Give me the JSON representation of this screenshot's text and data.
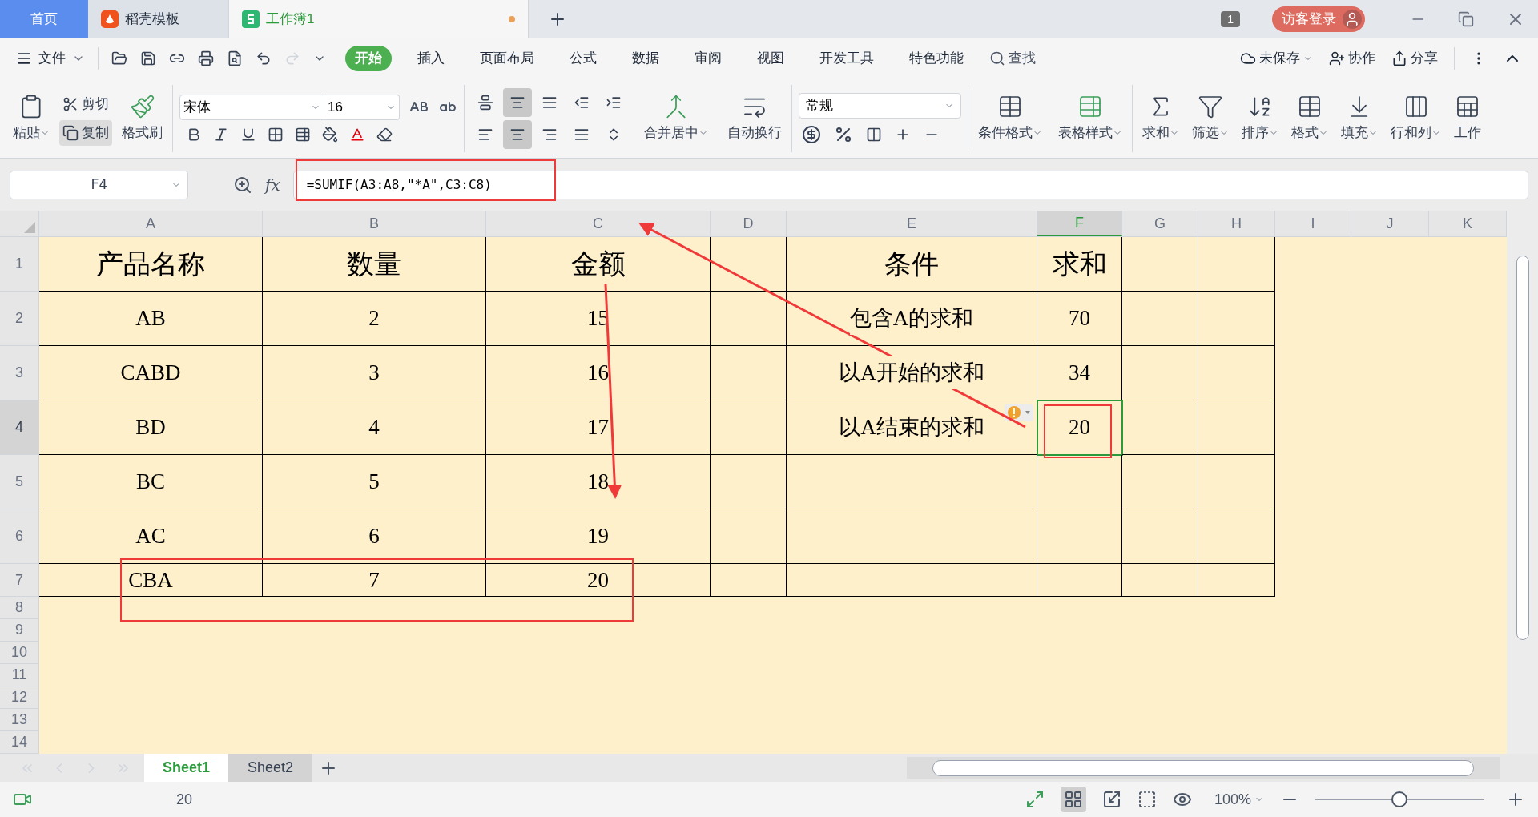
{
  "doc_tabs": [
    {
      "kind": "home",
      "label": "首页",
      "selected": false
    },
    {
      "kind": "docer",
      "label": "稻壳模板",
      "selected": false
    },
    {
      "kind": "workbook",
      "label": "工作簿1",
      "selected": true,
      "unsaved": true
    }
  ],
  "window_count": "1",
  "login_button": "访客登录",
  "file_menu": "文件",
  "menu_tabs": [
    {
      "label": "开始",
      "selected": true
    },
    {
      "label": "插入",
      "selected": false
    },
    {
      "label": "页面布局",
      "selected": false
    },
    {
      "label": "公式",
      "selected": false
    },
    {
      "label": "数据",
      "selected": false
    },
    {
      "label": "审阅",
      "selected": false
    },
    {
      "label": "视图",
      "selected": false
    },
    {
      "label": "开发工具",
      "selected": false
    },
    {
      "label": "特色功能",
      "selected": false
    }
  ],
  "search_label": "查找",
  "right_actions": [
    "未保存",
    "协作",
    "分享"
  ],
  "clipboard": {
    "paste": "粘贴",
    "cut": "剪切",
    "copy": {
      "label": "复制",
      "selected": true
    },
    "format_painter": "格式刷"
  },
  "font": {
    "name": "宋体",
    "size": "16"
  },
  "align_buttons": [
    {
      "selected": false
    },
    {
      "selected": true
    },
    {
      "selected": false
    },
    {
      "selected": false
    },
    {
      "selected": false
    },
    {
      "selected": false
    },
    {
      "selected": true
    },
    {
      "selected": false
    },
    {
      "selected": false
    },
    {
      "selected": false
    }
  ],
  "merge_buttons": [
    "合并居中",
    "自动换行"
  ],
  "number_format": "常规",
  "style_buttons": [
    "条件格式",
    "表格样式"
  ],
  "tool_buttons": [
    "求和",
    "筛选",
    "排序",
    "格式",
    "填充",
    "行和列",
    "工作"
  ],
  "name_box": "F4",
  "function_label": "fx",
  "formula": "=SUMIF(A3:A8,\"*A\",C3:C8)",
  "columns": [
    {
      "label": "A",
      "selected": false
    },
    {
      "label": "B",
      "selected": false
    },
    {
      "label": "C",
      "selected": false
    },
    {
      "label": "D",
      "selected": false
    },
    {
      "label": "E",
      "selected": false
    },
    {
      "label": "F",
      "selected": true
    },
    {
      "label": "G",
      "selected": false
    },
    {
      "label": "H",
      "selected": false
    },
    {
      "label": "I",
      "selected": false
    },
    {
      "label": "J",
      "selected": false
    },
    {
      "label": "K",
      "selected": false
    }
  ],
  "rows": [
    {
      "number": "1",
      "selected": false,
      "cells": [
        "产品名称",
        "数量",
        "金额",
        null,
        "条件",
        "求和",
        null,
        null
      ]
    },
    {
      "number": "2",
      "selected": false,
      "cells": [
        "AB",
        "2",
        "15",
        null,
        "包含A的求和",
        "70",
        null,
        null
      ]
    },
    {
      "number": "3",
      "selected": false,
      "cells": [
        "CABD",
        "3",
        "16",
        null,
        "以A开始的求和",
        "34",
        null,
        null
      ]
    },
    {
      "number": "4",
      "selected": true,
      "warning": true,
      "cells": [
        "BD",
        "4",
        "17",
        null,
        "以A结束的求和",
        "20",
        null,
        null
      ]
    },
    {
      "number": "5",
      "selected": false,
      "cells": [
        "BC",
        "5",
        "18",
        null,
        null,
        null,
        null,
        null
      ]
    },
    {
      "number": "6",
      "selected": false,
      "cells": [
        "AC",
        "6",
        "19",
        null,
        null,
        null,
        null,
        null
      ]
    },
    {
      "number": "7",
      "selected": false,
      "cells": [
        "CBA",
        "7",
        "20",
        null,
        null,
        null,
        null,
        null
      ]
    },
    {
      "number": "8",
      "selected": false
    },
    {
      "number": "9",
      "selected": false
    },
    {
      "number": "10",
      "selected": false
    },
    {
      "number": "11",
      "selected": false
    },
    {
      "number": "12",
      "selected": false
    },
    {
      "number": "13",
      "selected": false
    },
    {
      "number": "14",
      "selected": false
    }
  ],
  "sheet_tabs": [
    {
      "label": "Sheet1",
      "selected": true
    },
    {
      "label": "Sheet2",
      "selected": false
    }
  ],
  "status_value": "20",
  "zoom": {
    "label": "100%",
    "level": 0.5
  }
}
